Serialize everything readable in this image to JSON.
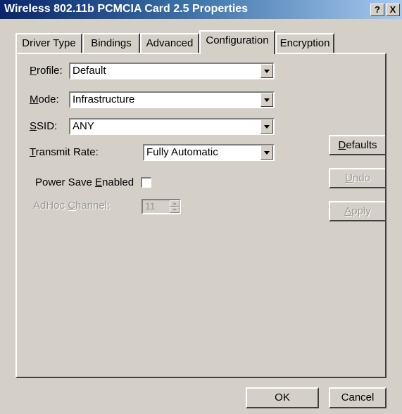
{
  "window": {
    "title": "Wireless 802.11b PCMCIA Card 2.5 Properties",
    "help_label": "?",
    "close_label": "X"
  },
  "tabs": [
    {
      "label": "Driver Type"
    },
    {
      "label": "Bindings"
    },
    {
      "label": "Advanced"
    },
    {
      "label": "Configuration",
      "active": true
    },
    {
      "label": "Encryption"
    }
  ],
  "form": {
    "profile": {
      "label_accel": "P",
      "label_rest": "rofile:",
      "value": "Default"
    },
    "mode": {
      "label_accel": "M",
      "label_rest": "ode:",
      "value": "Infrastructure"
    },
    "ssid": {
      "label_accel": "S",
      "label_rest": "SID:",
      "value": "ANY"
    },
    "transmit_rate": {
      "label_accel": "T",
      "label_rest": "ransmit Rate:",
      "value": "Fully Automatic"
    },
    "power_save": {
      "label_pre": "Power Save ",
      "label_accel": "E",
      "label_rest": "nabled",
      "checked": false
    },
    "adhoc_channel": {
      "label_pre": "AdHoc ",
      "label_accel": "C",
      "label_rest": "hannel:",
      "value": "11",
      "disabled": true
    }
  },
  "side_buttons": {
    "defaults": {
      "accel": "D",
      "rest": "efaults"
    },
    "undo": {
      "accel": "U",
      "rest": "ndo",
      "disabled": true
    },
    "apply": {
      "accel": "A",
      "rest": "pply",
      "disabled": true
    }
  },
  "footer": {
    "ok_label": "OK",
    "cancel_label": "Cancel"
  }
}
